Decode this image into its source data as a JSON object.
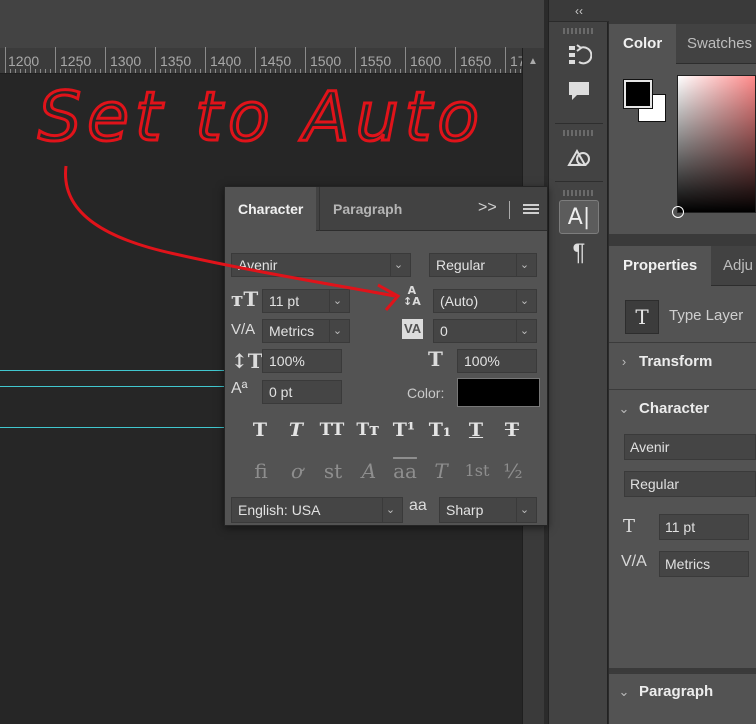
{
  "ruler": {
    "labels": [
      "1200",
      "1250",
      "1300",
      "1350",
      "1400",
      "1450",
      "1500",
      "1550",
      "1600",
      "1650",
      "17"
    ]
  },
  "dock": {
    "collapse_label": "‹‹",
    "icons": [
      "history-icon",
      "comments-icon",
      "shapes-icon",
      "character-panel-icon",
      "paragraph-panel-icon"
    ]
  },
  "color_panel": {
    "tabs": [
      "Color",
      "Swatches"
    ],
    "foreground": "#000000",
    "background": "#ffffff"
  },
  "properties_panel": {
    "tabs": [
      "Properties",
      "Adju"
    ],
    "type_layer_label": "Type Layer",
    "type_layer_icon": "T",
    "sections": {
      "transform": "Transform",
      "character": "Character",
      "paragraph": "Paragraph"
    },
    "font_family": "Avenir",
    "font_style": "Regular",
    "font_size": "11 pt",
    "kerning": "Metrics"
  },
  "character_panel": {
    "tabs": [
      "Character",
      "Paragraph"
    ],
    "expand_label": ">>",
    "font_family": "Avenir",
    "font_style": "Regular",
    "font_size": "11 pt",
    "leading": "(Auto)",
    "kerning": "Metrics",
    "tracking": "0",
    "vertical_scale": "100%",
    "horizontal_scale": "100%",
    "baseline_shift": "0 pt",
    "color_label": "Color:",
    "color_value": "#000000",
    "language": "English: USA",
    "antialias": "Sharp",
    "aa_label": "aa",
    "style_buttons": [
      "T",
      "T",
      "TT",
      "Tт",
      "T¹",
      "T₁",
      "T",
      "T"
    ],
    "opentype_buttons": [
      "fi",
      "ơ",
      "st",
      "A",
      "aa",
      "T",
      "1st",
      "½"
    ]
  },
  "annotation": {
    "text": "Set to Auto",
    "color": "#e0131a"
  }
}
